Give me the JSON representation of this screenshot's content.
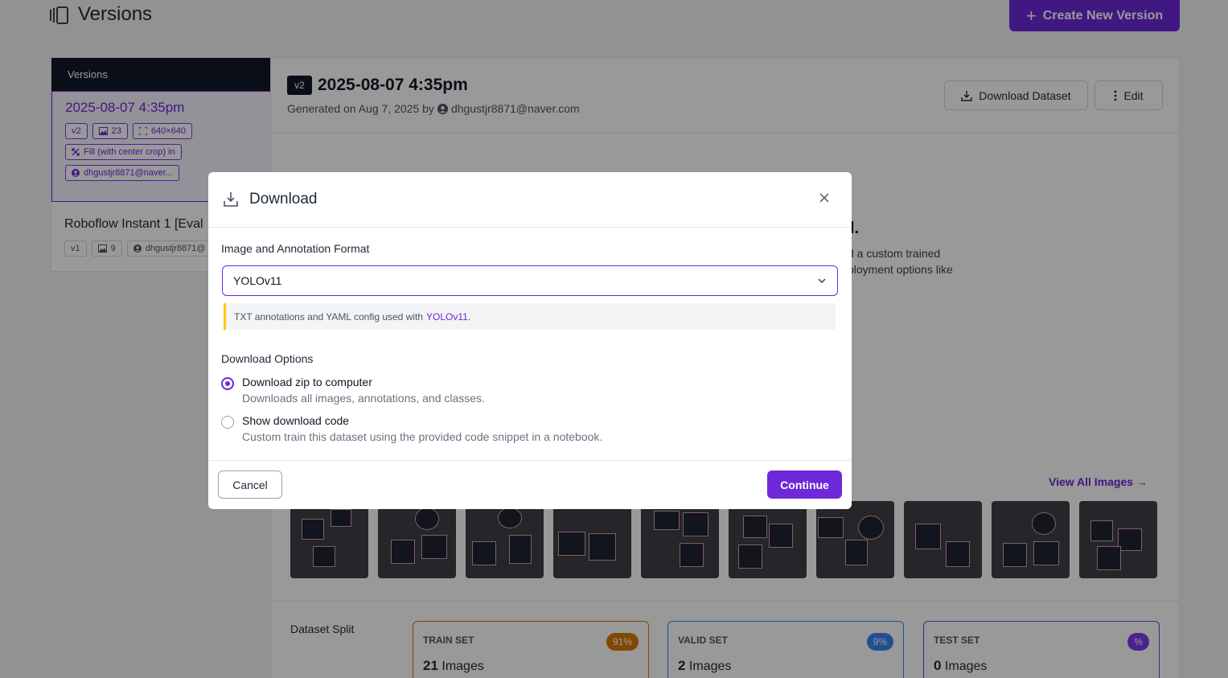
{
  "page": {
    "title": "Versions",
    "create_label": "Create New Version"
  },
  "sidebar": {
    "header": "Versions",
    "versions": [
      {
        "title": "2025-08-07 4:35pm",
        "version": "v2",
        "image_count": "23",
        "resolution": "640×640",
        "preprocess": "Fill (with center crop) in",
        "user": "dhgustjr8871@naver..."
      },
      {
        "title": "Roboflow Instant 1 [Eval",
        "version": "v1",
        "image_count": "9",
        "user": "dhgustjr8871@"
      }
    ]
  },
  "main": {
    "version_badge": "v2",
    "title": "2025-08-07 4:35pm",
    "generated_prefix": "Generated on Aug 7, 2025 by",
    "generated_user": "dhgustjr8871@naver.com",
    "download_label": "Download Dataset",
    "edit_label": "Edit",
    "bg_heading_fragment": "l.",
    "bg_line1": "d a custom trained",
    "bg_line2": "ployment options like",
    "view_all_label": "View All Images →",
    "split_label": "Dataset Split",
    "splits": [
      {
        "name": "TRAIN SET",
        "pct": "91%",
        "count": "21",
        "unit": "Images",
        "color": "#d97706"
      },
      {
        "name": "VALID SET",
        "pct": "9%",
        "count": "2",
        "unit": "Images",
        "color": "#3b82f6"
      },
      {
        "name": "TEST SET",
        "pct": "%",
        "count": "0",
        "unit": "Images",
        "color": "#7c3aed"
      }
    ]
  },
  "modal": {
    "title": "Download",
    "format_label": "Image and Annotation Format",
    "format_value": "YOLOv11",
    "note_text": "TXT annotations and YAML config used with",
    "note_link": "YOLOv11",
    "note_suffix": ".",
    "options_label": "Download Options",
    "options": [
      {
        "title": "Download zip to computer",
        "desc": "Downloads all images, annotations, and classes.",
        "checked": true
      },
      {
        "title": "Show download code",
        "desc": "Custom train this dataset using the provided code snippet in a notebook.",
        "checked": false
      }
    ],
    "cancel_label": "Cancel",
    "continue_label": "Continue"
  },
  "icons": {
    "versions": "versions-icon",
    "image": "image-icon",
    "resize": "resize-icon",
    "user": "user-icon",
    "download": "download-icon",
    "more": "more-vertical-icon",
    "close": "close-icon",
    "chevron": "chevron-down-icon"
  },
  "colors": {
    "accent": "#6d28d9",
    "note_border": "#facc15"
  }
}
